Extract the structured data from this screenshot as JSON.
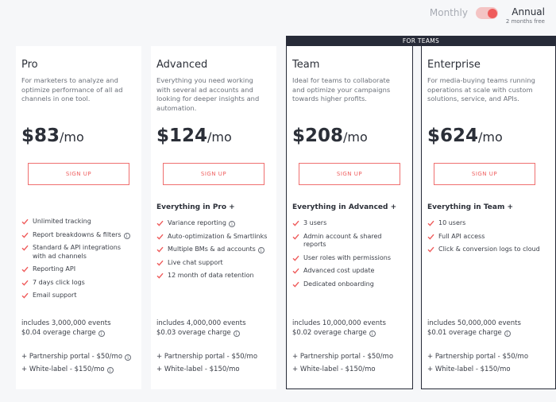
{
  "billing": {
    "monthly_label": "Monthly",
    "annual_label": "Annual",
    "annual_note": "2 months free",
    "selected": "Annual"
  },
  "teams_banner": "FOR TEAMS",
  "plans": [
    {
      "name": "Pro",
      "description": "For marketers to analyze and optimize performance of all ad channels in one tool.",
      "price": "$83",
      "per": "/mo",
      "signup_label": "SIGN UP",
      "everything": "",
      "features": [
        {
          "text": "Unlimited tracking",
          "info": false
        },
        {
          "text": "Report breakdowns & filters",
          "info": true
        },
        {
          "text": "Standard & API integrations with ad channels",
          "info": false
        },
        {
          "text": "Reporting API",
          "info": false
        },
        {
          "text": "7 days click logs",
          "info": false
        },
        {
          "text": "Email support",
          "info": false
        }
      ],
      "events": "includes 3,000,000 events",
      "overage": "$0.04 overage charge",
      "addons": [
        "+ Partnership portal - $50/mo",
        "+ White-label - $150/mo"
      ]
    },
    {
      "name": "Advanced",
      "description": "Everything you need working with several ad accounts and looking for deeper insights and automation.",
      "price": "$124",
      "per": "/mo",
      "signup_label": "SIGN UP",
      "everything": "Everything in Pro +",
      "features": [
        {
          "text": "Variance reporting",
          "info": true
        },
        {
          "text": "Auto-optimization & Smartlinks",
          "info": false
        },
        {
          "text": "Multiple BMs & ad accounts",
          "info": true
        },
        {
          "text": "Live chat support",
          "info": false
        },
        {
          "text": "12 month of data retention",
          "info": false
        }
      ],
      "events": "includes 4,000,000 events",
      "overage": "$0.03 overage charge",
      "addons": [
        "+ Partnership portal - $50/mo",
        "+ White-label - $150/mo"
      ]
    },
    {
      "name": "Team",
      "description": "Ideal for teams to collaborate and optimize your campaigns towards higher profits.",
      "price": "$208",
      "per": "/mo",
      "signup_label": "SIGN UP",
      "everything": "Everything in Advanced +",
      "features": [
        {
          "text": "3 users",
          "info": false
        },
        {
          "text": "Admin account & shared reports",
          "info": false
        },
        {
          "text": "User roles with permissions",
          "info": false
        },
        {
          "text": "Advanced cost update",
          "info": false
        },
        {
          "text": "Dedicated onboarding",
          "info": false
        }
      ],
      "events": "includes 10,000,000 events",
      "overage": "$0.02 overage charge",
      "addons": [
        "+ Partnership portal - $50/mo",
        "+ White-label - $150/mo"
      ]
    },
    {
      "name": "Enterprise",
      "description": "For media-buying teams running operations at scale with custom solutions, service, and APIs.",
      "price": "$624",
      "per": "/mo",
      "signup_label": "SIGN UP",
      "everything": "Everything in Team +",
      "features": [
        {
          "text": "10 users",
          "info": false
        },
        {
          "text": "Full API access",
          "info": false
        },
        {
          "text": "Click & conversion logs to cloud",
          "info": false
        }
      ],
      "events": "includes 50,000,000 events",
      "overage": "$0.01 overage charge",
      "addons": [
        "+ Partnership portal - $50/mo",
        "+ White-label - $150/mo"
      ]
    }
  ],
  "colors": {
    "accent": "#ef5b5b",
    "dark": "#272b38",
    "background": "#f6f7f9"
  }
}
